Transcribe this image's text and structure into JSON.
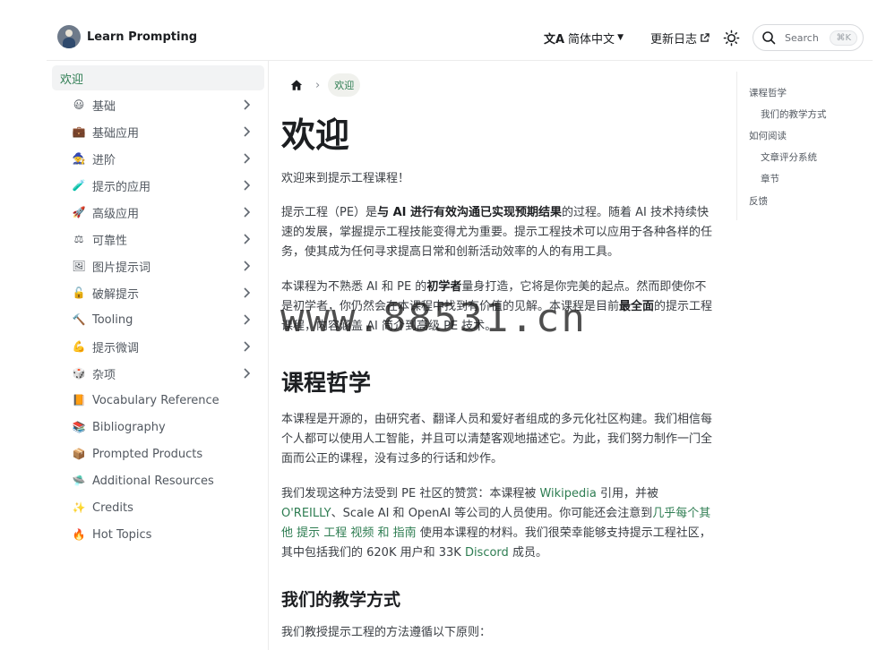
{
  "header": {
    "brand": "Learn Prompting",
    "language": "简体中文",
    "changelog": "更新日志",
    "search_placeholder": "Search",
    "search_shortcut": "⌘K"
  },
  "sidebar": {
    "items": [
      {
        "emoji": "",
        "label": "欢迎",
        "active": true,
        "has_children": false
      },
      {
        "emoji": "😃",
        "label": "基础",
        "has_children": true
      },
      {
        "emoji": "💼",
        "label": "基础应用",
        "has_children": true
      },
      {
        "emoji": "🧙",
        "label": "进阶",
        "has_children": true
      },
      {
        "emoji": "🧪",
        "label": "提示的应用",
        "has_children": true
      },
      {
        "emoji": "🚀",
        "label": "高级应用",
        "has_children": true
      },
      {
        "emoji": "⚖",
        "label": "可靠性",
        "has_children": true
      },
      {
        "emoji": "🖼",
        "label": "图片提示词",
        "has_children": true
      },
      {
        "emoji": "🔓",
        "label": "破解提示",
        "has_children": true
      },
      {
        "emoji": "🔨",
        "label": "Tooling",
        "has_children": true
      },
      {
        "emoji": "💪",
        "label": "提示微调",
        "has_children": true
      },
      {
        "emoji": "🎲",
        "label": "杂项",
        "has_children": true
      },
      {
        "emoji": "📙",
        "label": "Vocabulary Reference",
        "has_children": false
      },
      {
        "emoji": "📚",
        "label": "Bibliography",
        "has_children": false
      },
      {
        "emoji": "📦",
        "label": "Prompted Products",
        "has_children": false
      },
      {
        "emoji": "🛸",
        "label": "Additional Resources",
        "has_children": false
      },
      {
        "emoji": "✨",
        "label": "Credits",
        "has_children": false
      },
      {
        "emoji": "🔥",
        "label": "Hot Topics",
        "has_children": false
      }
    ]
  },
  "breadcrumb": {
    "current": "欢迎"
  },
  "content": {
    "title": "欢迎",
    "intro": "欢迎来到提示工程课程！",
    "p1": {
      "a": "提示工程（PE）是",
      "b": "与 AI 进行有效沟通已实现预期结果",
      "c": "的过程。随着 AI 技术持续快速的发展，掌握提示工程技能变得尤为重要。提示工程技术可以应用于各种各样的任务，使其成为任何寻求提高日常和创新活动效率的人的有用工具。"
    },
    "p2": {
      "a": "本课程为不熟悉 AI 和 PE 的",
      "b": "初学者",
      "c": "量身打造，它将是你完美的起点。然而即使你不是初学者，你仍然会在本课程中找到有价值的见解。本课程是目前",
      "d": "最全面",
      "e": "的提示工程课程，内容涵盖 AI 简介到高级 PE 技术。"
    },
    "h2": "课程哲学",
    "p3": "本课程是开源的，由研究者、翻译人员和爱好者组成的多元化社区构建。我们相信每个人都可以使用人工智能，并且可以清楚客观地描述它。为此，我们努力制作一门全面而公正的课程，没有过多的行话和炒作。",
    "p4": {
      "a": "我们发现这种方法受到 PE 社区的赞赏：本课程被 ",
      "wiki": "Wikipedia",
      "b": " 引用，并被 ",
      "oreilly": "O'REILLY",
      "c": "、Scale AI 和 OpenAI 等公司的人员使用。你可能还会注意到",
      "others": "几乎每个其他 提示 工程 视频 和 指南",
      "d": " 使用本课程的材料。我们很荣幸能够支持提示工程社区，其中包括我们的 620K 用户和 33K ",
      "discord": "Discord",
      "e": " 成员。"
    },
    "h3": "我们的教学方式",
    "p5": "我们教授提示工程的方法遵循以下原则："
  },
  "toc": [
    {
      "label": "课程哲学",
      "level": 1
    },
    {
      "label": "我们的教学方式",
      "level": 2
    },
    {
      "label": "如何阅读",
      "level": 1
    },
    {
      "label": "文章评分系统",
      "level": 2
    },
    {
      "label": "章节",
      "level": 2
    },
    {
      "label": "反馈",
      "level": 1
    }
  ],
  "watermark": "www.88531.cn",
  "colors": {
    "accent": "#2e7d52",
    "text": "#1c1e21",
    "muted": "#525860"
  }
}
